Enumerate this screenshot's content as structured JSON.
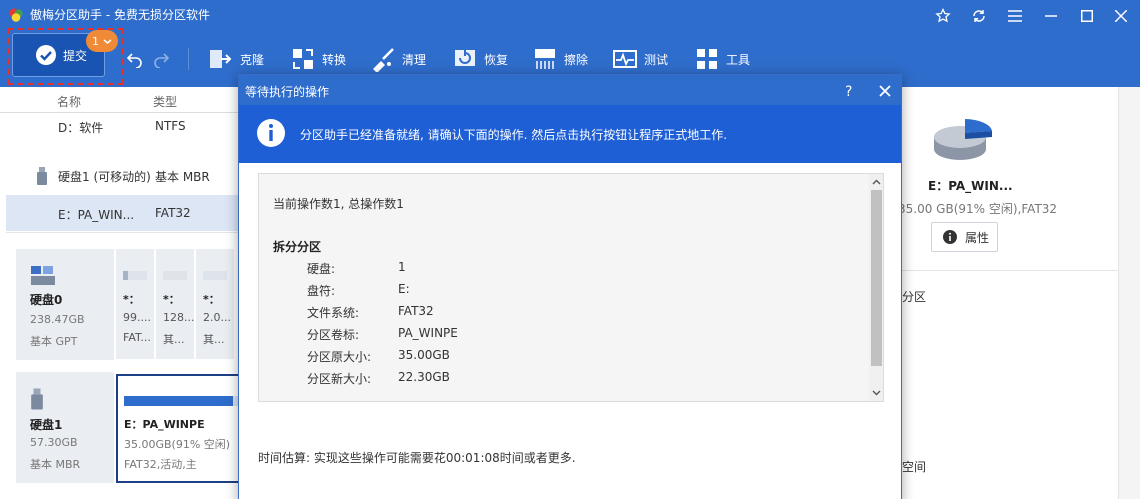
{
  "window": {
    "title": "傲梅分区助手 - 免费无损分区软件"
  },
  "toolbar": {
    "commit_label": "提交",
    "pending_count": "1",
    "tools": [
      {
        "label": "克隆",
        "icon": "clone-icon"
      },
      {
        "label": "转换",
        "icon": "convert-icon"
      },
      {
        "label": "清理",
        "icon": "clean-icon"
      },
      {
        "label": "恢复",
        "icon": "recover-icon"
      },
      {
        "label": "擦除",
        "icon": "wipe-icon"
      },
      {
        "label": "测试",
        "icon": "test-icon"
      },
      {
        "label": "工具",
        "icon": "tools-icon"
      }
    ]
  },
  "list": {
    "col_name": "名称",
    "col_type": "类型",
    "rows": [
      {
        "name": "D：软件",
        "type": "NTFS"
      },
      {
        "name": "硬盘1 (可移动的)",
        "type": "基本 MBR"
      },
      {
        "name": "E：PA_WIN...",
        "type": "FAT32"
      }
    ]
  },
  "disks": [
    {
      "name": "硬盘0",
      "size": "238.47GB",
      "type": "基本 GPT",
      "parts": [
        {
          "letter": "*：",
          "size": "99....",
          "fs": "FAT..."
        },
        {
          "letter": "*：",
          "size": "128....",
          "fs": "其..."
        },
        {
          "letter": "*：",
          "size": "2.0...",
          "fs": "其..."
        }
      ]
    },
    {
      "name": "硬盘1",
      "size": "57.30GB",
      "type": "基本 MBR",
      "selected_part": {
        "name": "E：PA_WINPE",
        "size": "35.00GB(91% 空闲)",
        "fs": "FAT32,活动,主",
        "used_fraction": 0.09
      }
    }
  ],
  "side": {
    "name": "E：PA_WIN...",
    "detail": "35.00 GB(91% 空闲),FAT32",
    "properties_label": "属性",
    "cut_text_1": "分区",
    "cut_text_2": "空间"
  },
  "dialog": {
    "title": "等待执行的操作",
    "info": "分区助手已经准备就绪, 请确认下面的操作. 然后点击执行按钮让程序正式地工作.",
    "count_text": "当前操作数1, 总操作数1",
    "op_name": "拆分分区",
    "fields": [
      {
        "key": "硬盘:",
        "value": "1"
      },
      {
        "key": "盘符:",
        "value": "E:"
      },
      {
        "key": "文件系统:",
        "value": "FAT32"
      },
      {
        "key": "分区卷标:",
        "value": "PA_WINPE"
      },
      {
        "key": "分区原大小:",
        "value": "35.00GB"
      },
      {
        "key": "分区新大小:",
        "value": "22.30GB"
      }
    ],
    "estimate": "时间估算: 实现这些操作可能需要花00:01:08时间或者更多."
  },
  "colors": {
    "titlebar": "#2f6dcc",
    "info_banner": "#1f5fd6",
    "commit_outline": "#e8312a",
    "badge": "#f08a36"
  }
}
